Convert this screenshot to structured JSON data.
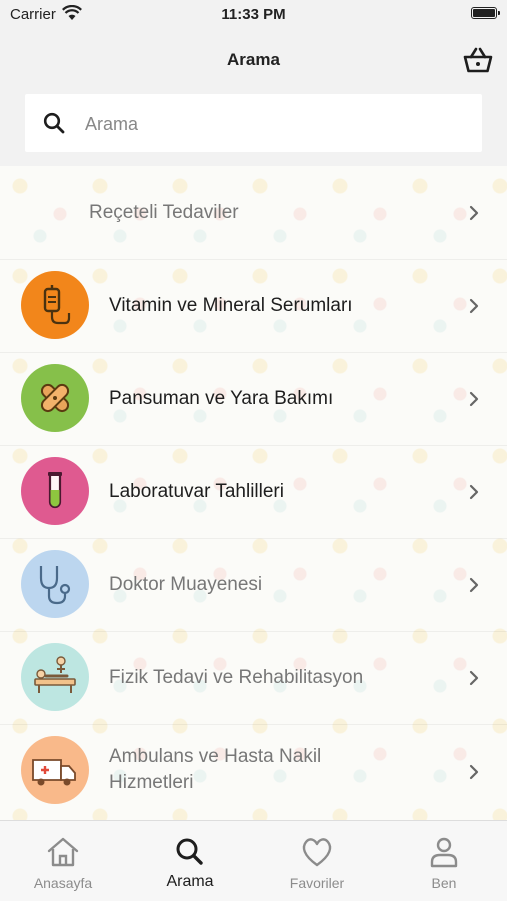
{
  "status_bar": {
    "carrier": "Carrier",
    "time": "11:33 PM"
  },
  "nav": {
    "title": "Arama"
  },
  "search": {
    "placeholder": "Arama"
  },
  "categories": [
    {
      "label": "Reçeteli Tedaviler",
      "icon": "prescription"
    },
    {
      "label": "Vitamin ve Mineral Serumları",
      "icon": "iv-bag-icon",
      "color": "#f2861b"
    },
    {
      "label": "Pansuman ve Yara Bakımı",
      "icon": "bandage-icon",
      "color": "#86c04a"
    },
    {
      "label": "Laboratuvar Tahlilleri",
      "icon": "test-tube-icon",
      "color": "#df5a90"
    },
    {
      "label": "Doktor Muayenesi",
      "icon": "stethoscope-icon",
      "color": "#bcd6ef"
    },
    {
      "label": "Fizik Tedavi ve Rehabilitasyon",
      "icon": "physiotherapy-icon",
      "color": "#bde6e1"
    },
    {
      "label": "Ambulans ve Hasta Nakil Hizmetleri",
      "label_line1": "Ambulans ve Hasta Nakil",
      "label_line2": "Hizmetleri",
      "icon": "ambulance-icon",
      "color": "#f9b98a"
    }
  ],
  "tabs": [
    {
      "label": "Anasayfa",
      "icon": "home-icon"
    },
    {
      "label": "Arama",
      "icon": "search-icon",
      "active": true
    },
    {
      "label": "Favoriler",
      "icon": "heart-icon"
    },
    {
      "label": "Ben",
      "icon": "user-icon"
    }
  ]
}
